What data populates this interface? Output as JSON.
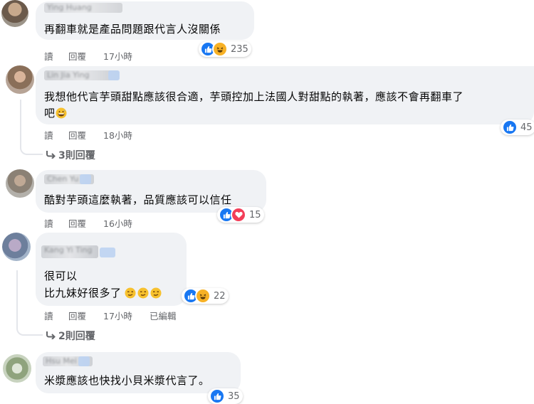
{
  "comments": [
    {
      "name": "Ying Huang",
      "text_lines": [
        "再翻車就是產品問題跟代言人沒關係"
      ],
      "actions": {
        "reply": "讀",
        "share": "回覆",
        "time": "17小時"
      },
      "reactions": {
        "icons": [
          "like-icon",
          "haha-icon"
        ],
        "count": "235"
      }
    },
    {
      "name": "Lin Jia Ying",
      "text_lines": [
        "我想他代言芋頭甜點應該很合適，芋頭控加上法國人對甜點的執著，應該不會再翻車了",
        "吧"
      ],
      "actions": {
        "reply": "讀",
        "share": "回覆",
        "time": "18小時"
      },
      "reactions": {
        "icons": [
          "like-icon"
        ],
        "count": "45"
      },
      "replies_link": "3則回覆"
    },
    {
      "name": "Chen Yu",
      "text_lines": [
        "酷對芋頭這麼執著，品質應該可以信任"
      ],
      "actions": {
        "reply": "讀",
        "share": "回覆",
        "time": "16小時"
      },
      "reactions": {
        "icons": [
          "like-icon",
          "love-icon"
        ],
        "count": "15"
      }
    },
    {
      "name": "Kang Yi Ting",
      "text_lines": [
        "很可以",
        "比九妹好很多了"
      ],
      "actions": {
        "reply": "讀",
        "share": "回覆",
        "time": "17小時",
        "edited": "已編輯"
      },
      "reactions": {
        "icons": [
          "like-icon",
          "haha-icon"
        ],
        "count": "22"
      },
      "replies_link": "2則回覆"
    },
    {
      "name": "Hsu Mei",
      "text_lines": [
        "米漿應該也快找小貝米漿代言了。"
      ],
      "reactions": {
        "icons": [
          "like-icon"
        ],
        "count": "35"
      }
    }
  ],
  "colors": {
    "like": "#1877f2",
    "haha": "#f7b125",
    "love": "#f33e58",
    "bubble": "#f0f2f5",
    "meta": "#65676b"
  }
}
